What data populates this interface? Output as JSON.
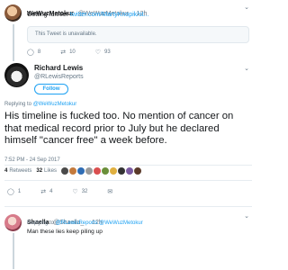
{
  "tweet_top": {
    "display_name": "WeWuzMetokur",
    "handle": "@WeWuzMetokur",
    "time": "· 12h",
    "text": "Getting funnier",
    "link": "twitter.com/MartyKnopik/st...",
    "quoted_unavailable": "This Tweet is unavailable.",
    "replies": "8",
    "retweets": "10",
    "likes": "93"
  },
  "main_tweet": {
    "display_name": "Richard Lewis",
    "handle": "@RLewisReports",
    "follow_label": "Follow",
    "replying_prefix": "Replying to",
    "replying_to": "@WeWuzMetokur",
    "text": "His timeline is fucked too. No mention of cancer on that medical record prior to July but he declared himself \"cancer free\" a week before.",
    "timestamp": "7:52 PM - 24 Sep 2017",
    "retweets_count": "4",
    "retweets_label": "Retweets",
    "likes_count": "32",
    "likes_label": "Likes",
    "replies": "1",
    "retweets": "4",
    "likes": "32"
  },
  "reply_tweet": {
    "display_name": "Shaella",
    "handle": "@Shaella_",
    "time": "· 12h",
    "replying_prefix": "Replying to",
    "replying_to": "@RLewisReports @WeWuzMetokur",
    "text": "Man these lies keep piling up"
  },
  "icons": {
    "reply": "reply-icon",
    "retweet": "retweet-icon",
    "like": "heart-icon",
    "dm": "envelope-icon",
    "chevron": "chevron-down-icon"
  },
  "colors": {
    "link": "#1da1f2",
    "muted": "#657786",
    "text": "#14171a",
    "retweet_active": "#17bf63"
  }
}
